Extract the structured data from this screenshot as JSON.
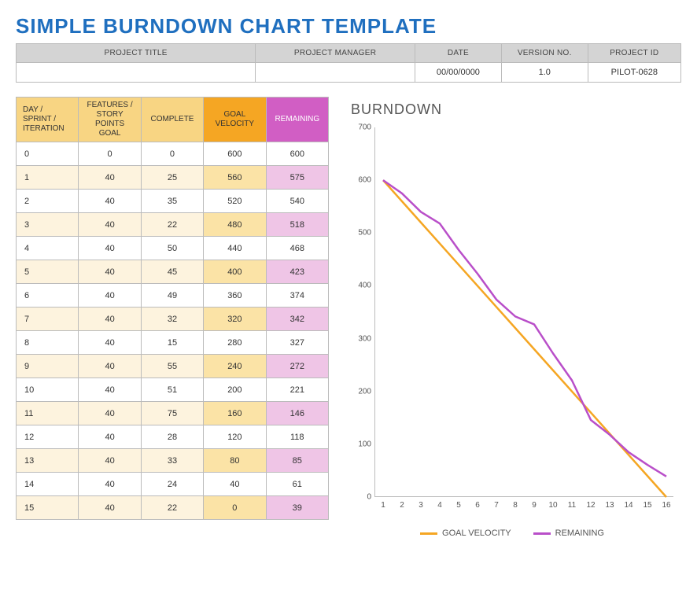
{
  "title": "SIMPLE BURNDOWN CHART TEMPLATE",
  "project_headers": {
    "title": "PROJECT TITLE",
    "manager": "PROJECT MANAGER",
    "date": "DATE",
    "version": "VERSION NO.",
    "id": "PROJECT ID"
  },
  "project_values": {
    "title": "",
    "manager": "",
    "date": "00/00/0000",
    "version": "1.0",
    "id": "PILOT-0628"
  },
  "table_headers": {
    "day": "DAY / SPRINT / ITERATION",
    "goal": "FEATURES / STORY POINTS GOAL",
    "complete": "COMPLETE",
    "velocity": "GOAL VELOCITY",
    "remaining": "REMAINING"
  },
  "rows": [
    {
      "day": "0",
      "goal": "0",
      "complete": "0",
      "velocity": "600",
      "remaining": "600"
    },
    {
      "day": "1",
      "goal": "40",
      "complete": "25",
      "velocity": "560",
      "remaining": "575"
    },
    {
      "day": "2",
      "goal": "40",
      "complete": "35",
      "velocity": "520",
      "remaining": "540"
    },
    {
      "day": "3",
      "goal": "40",
      "complete": "22",
      "velocity": "480",
      "remaining": "518"
    },
    {
      "day": "4",
      "goal": "40",
      "complete": "50",
      "velocity": "440",
      "remaining": "468"
    },
    {
      "day": "5",
      "goal": "40",
      "complete": "45",
      "velocity": "400",
      "remaining": "423"
    },
    {
      "day": "6",
      "goal": "40",
      "complete": "49",
      "velocity": "360",
      "remaining": "374"
    },
    {
      "day": "7",
      "goal": "40",
      "complete": "32",
      "velocity": "320",
      "remaining": "342"
    },
    {
      "day": "8",
      "goal": "40",
      "complete": "15",
      "velocity": "280",
      "remaining": "327"
    },
    {
      "day": "9",
      "goal": "40",
      "complete": "55",
      "velocity": "240",
      "remaining": "272"
    },
    {
      "day": "10",
      "goal": "40",
      "complete": "51",
      "velocity": "200",
      "remaining": "221"
    },
    {
      "day": "11",
      "goal": "40",
      "complete": "75",
      "velocity": "160",
      "remaining": "146"
    },
    {
      "day": "12",
      "goal": "40",
      "complete": "28",
      "velocity": "120",
      "remaining": "118"
    },
    {
      "day": "13",
      "goal": "40",
      "complete": "33",
      "velocity": "80",
      "remaining": "85"
    },
    {
      "day": "14",
      "goal": "40",
      "complete": "24",
      "velocity": "40",
      "remaining": "61"
    },
    {
      "day": "15",
      "goal": "40",
      "complete": "22",
      "velocity": "0",
      "remaining": "39"
    }
  ],
  "chart_title": "BURNDOWN",
  "legend": {
    "velocity": "GOAL VELOCITY",
    "remaining": "REMAINING"
  },
  "chart_data": {
    "type": "line",
    "title": "BURNDOWN",
    "xlabel": "",
    "ylabel": "",
    "x": [
      1,
      2,
      3,
      4,
      5,
      6,
      7,
      8,
      9,
      10,
      11,
      12,
      13,
      14,
      15,
      16
    ],
    "ylim": [
      0,
      700
    ],
    "yticks": [
      0,
      100,
      200,
      300,
      400,
      500,
      600,
      700
    ],
    "series": [
      {
        "name": "GOAL VELOCITY",
        "color": "#f5a623",
        "values": [
          600,
          560,
          520,
          480,
          440,
          400,
          360,
          320,
          280,
          240,
          200,
          160,
          120,
          80,
          40,
          0
        ]
      },
      {
        "name": "REMAINING",
        "color": "#b94fc9",
        "values": [
          600,
          575,
          540,
          518,
          468,
          423,
          374,
          342,
          327,
          272,
          221,
          146,
          118,
          85,
          61,
          39
        ]
      }
    ]
  }
}
